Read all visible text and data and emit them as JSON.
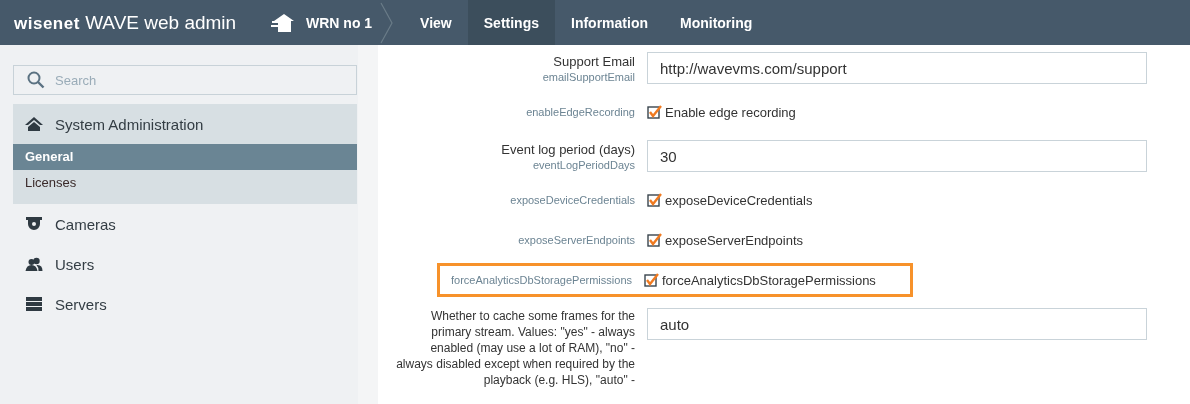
{
  "header": {
    "logo_brand": "wisenet",
    "logo_product": "WAVE web admin",
    "system": "WRN no 1",
    "nav": [
      {
        "label": "View",
        "selected": false
      },
      {
        "label": "Settings",
        "selected": true
      },
      {
        "label": "Information",
        "selected": false
      },
      {
        "label": "Monitoring",
        "selected": false
      }
    ]
  },
  "sidebar": {
    "search": {
      "placeholder": "Search"
    },
    "sections": [
      {
        "kind": "home",
        "label": "System Administration",
        "expanded": true,
        "children": [
          {
            "label": "General",
            "selected": true
          },
          {
            "label": "Licenses",
            "selected": false
          }
        ]
      },
      {
        "kind": "camera",
        "label": "Cameras",
        "expanded": false
      },
      {
        "kind": "users",
        "label": "Users",
        "expanded": false
      },
      {
        "kind": "servers",
        "label": "Servers",
        "expanded": false
      }
    ]
  },
  "settings": [
    {
      "kind": "text",
      "label": "Support Email",
      "key": "emailSupportEmail",
      "value": "http://wavevms.com/support",
      "highlighted": false
    },
    {
      "kind": "checkbox",
      "key": "enableEdgeRecording",
      "text": "Enable edge recording",
      "checked": true,
      "highlighted": false
    },
    {
      "kind": "text",
      "label": "Event log period (days)",
      "key": "eventLogPeriodDays",
      "value": "30",
      "highlighted": false
    },
    {
      "kind": "checkbox",
      "key": "exposeDeviceCredentials",
      "text": "exposeDeviceCredentials",
      "checked": true,
      "highlighted": false
    },
    {
      "kind": "checkbox",
      "key": "exposeServerEndpoints",
      "text": "exposeServerEndpoints",
      "checked": true,
      "highlighted": false
    },
    {
      "kind": "checkbox",
      "key": "forceAnalyticsDbStoragePermissions",
      "text": "forceAnalyticsDbStoragePermissions",
      "checked": true,
      "highlighted": true
    },
    {
      "kind": "text",
      "label": "Whether to cache some frames for the primary stream. Values: \"yes\" - always enabled (may use a lot of RAM), \"no\" - always disabled except when required by the playback (e.g. HLS), \"auto\" -",
      "value": "auto",
      "highlighted": false
    }
  ]
}
